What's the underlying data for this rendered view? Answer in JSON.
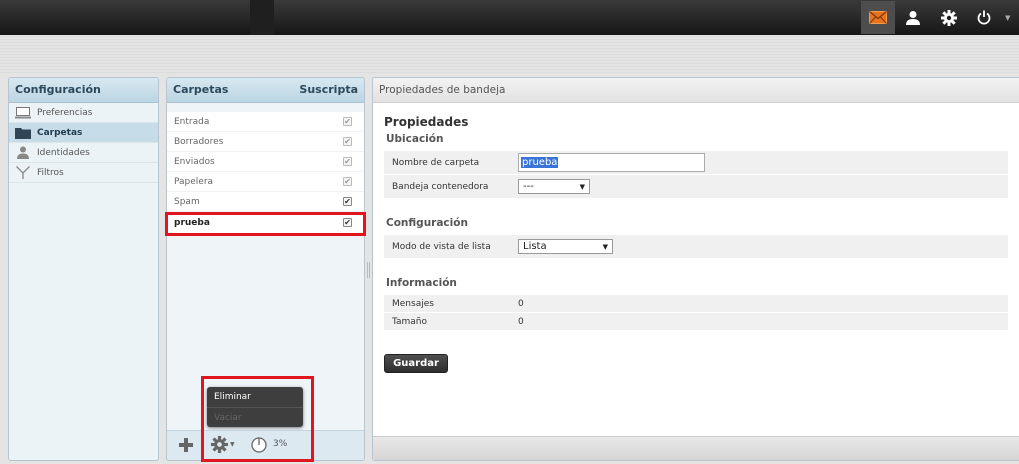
{
  "topbar": {
    "icons": [
      "mail-icon",
      "user-icon",
      "gear-icon",
      "power-icon"
    ],
    "accent_color": "#e8731d"
  },
  "settings": {
    "header": "Configuración",
    "items": [
      {
        "label": "Preferencias",
        "icon": "monitor-icon"
      },
      {
        "label": "Carpetas",
        "icon": "folder-icon"
      },
      {
        "label": "Identidades",
        "icon": "person-icon"
      },
      {
        "label": "Filtros",
        "icon": "filter-icon"
      }
    ]
  },
  "folders": {
    "header": "Carpetas",
    "subscribed_header": "Suscripta",
    "items": [
      {
        "name": "Entrada",
        "subscribed": true,
        "locked": true
      },
      {
        "name": "Borradores",
        "subscribed": true,
        "locked": true
      },
      {
        "name": "Enviados",
        "subscribed": true,
        "locked": true
      },
      {
        "name": "Papelera",
        "subscribed": true,
        "locked": true
      },
      {
        "name": "Spam",
        "subscribed": true,
        "locked": false
      },
      {
        "name": "prueba",
        "subscribed": true,
        "locked": false
      }
    ],
    "menu": {
      "delete": "Eliminar",
      "empty": "Vaciar"
    },
    "quota": "3%",
    "highlight_color": "#e0151d"
  },
  "properties": {
    "header": "Propiedades de bandeja",
    "title": "Propiedades",
    "location_section": "Ubicación",
    "folder_name_label": "Nombre de carpeta",
    "folder_name_value": "prueba",
    "parent_label": "Bandeja contenedora",
    "parent_value": "---",
    "config_section": "Configuración",
    "view_mode_label": "Modo de vista de lista",
    "view_mode_value": "Lista",
    "info_section": "Información",
    "messages_label": "Mensajes",
    "messages_value": "0",
    "size_label": "Tamaño",
    "size_value": "0",
    "save_label": "Guardar"
  }
}
